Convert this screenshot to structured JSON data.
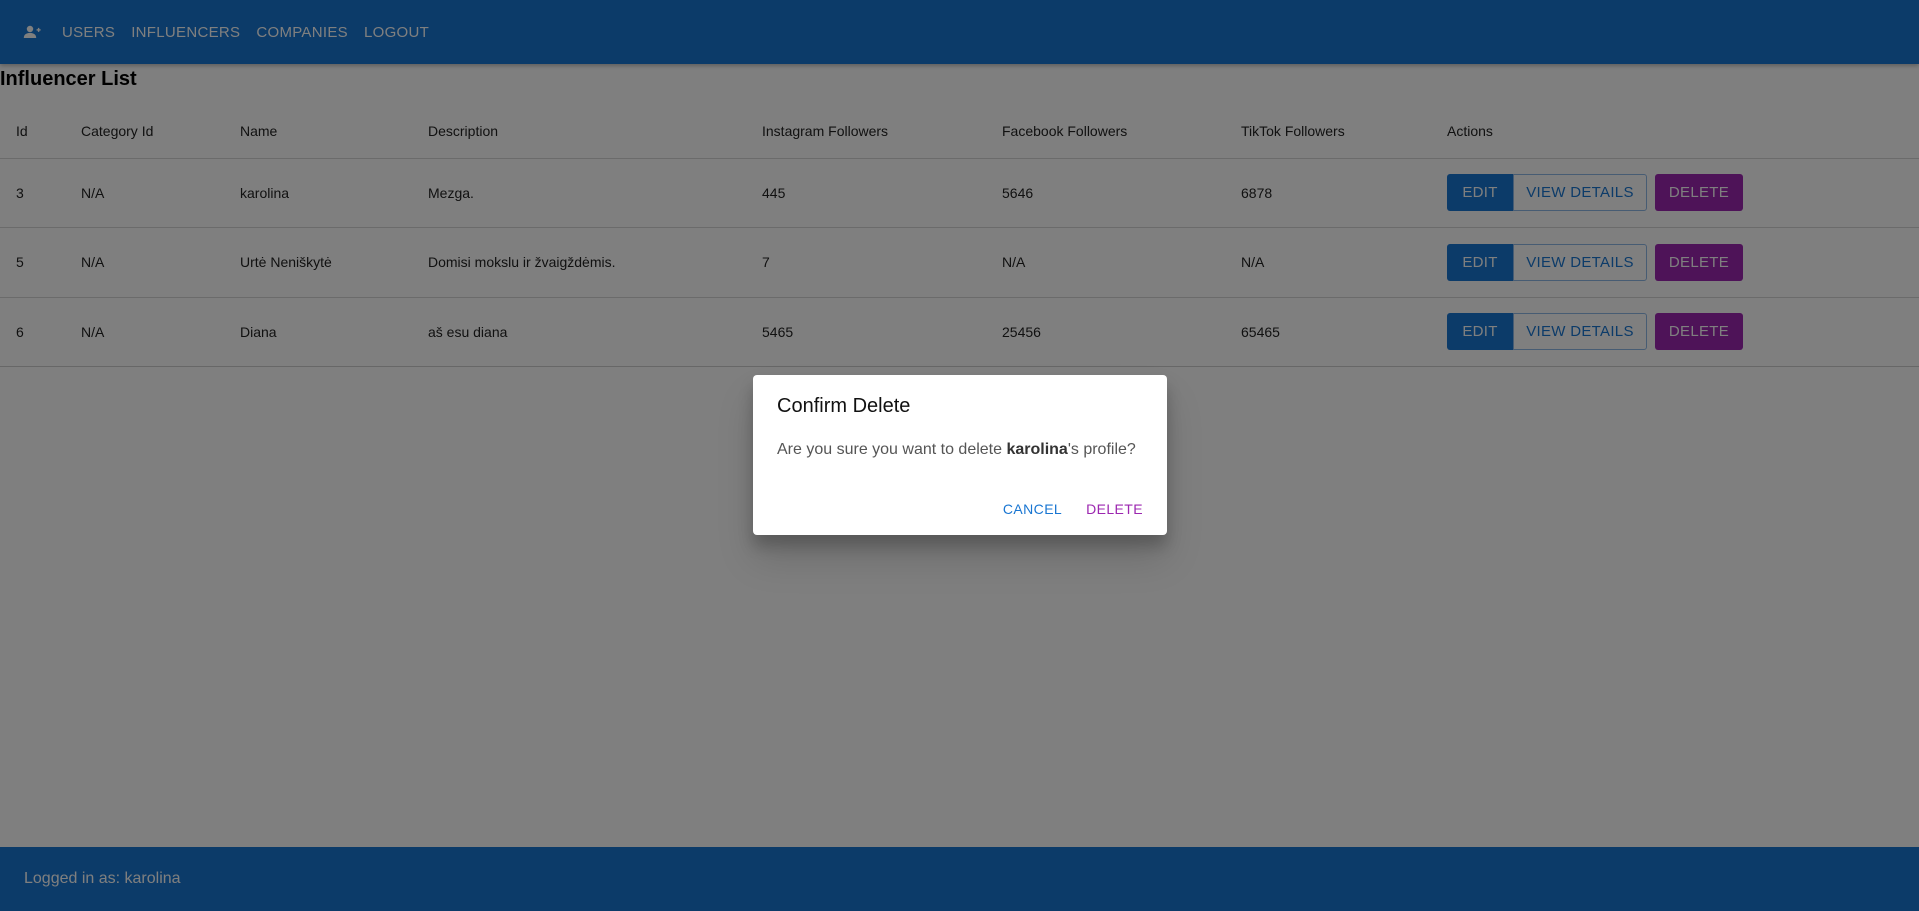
{
  "nav": {
    "items": [
      "USERS",
      "INFLUENCERS",
      "COMPANIES",
      "LOGOUT"
    ]
  },
  "page": {
    "title": "Influencer List"
  },
  "table": {
    "headers": [
      "Id",
      "Category Id",
      "Name",
      "Description",
      "Instagram Followers",
      "Facebook Followers",
      "TikTok Followers",
      "Actions"
    ],
    "rows": [
      {
        "id": "3",
        "category": "N/A",
        "name": "karolina",
        "description": "Mezga.",
        "instagram": "445",
        "facebook": "5646",
        "tiktok": "6878"
      },
      {
        "id": "5",
        "category": "N/A",
        "name": "Urtė Neniškytė",
        "description": "Domisi mokslu ir žvaigždėmis.",
        "instagram": "7",
        "facebook": "N/A",
        "tiktok": "N/A"
      },
      {
        "id": "6",
        "category": "N/A",
        "name": "Diana",
        "description": "aš esu diana",
        "instagram": "5465",
        "facebook": "25456",
        "tiktok": "65465"
      }
    ],
    "actions": {
      "edit": "EDIT",
      "view": "VIEW DETAILS",
      "delete": "DELETE"
    }
  },
  "footer": {
    "text": "Logged in as: karolina"
  },
  "dialog": {
    "title": "Confirm Delete",
    "text_before": "Are you sure you want to delete ",
    "name": "karolina",
    "text_after": "'s profile?",
    "cancel": "CANCEL",
    "confirm": "DELETE"
  },
  "colors": {
    "primary": "#1976d2",
    "secondary": "#9c27b0"
  },
  "icons": {
    "appbar": "person-add-icon"
  }
}
